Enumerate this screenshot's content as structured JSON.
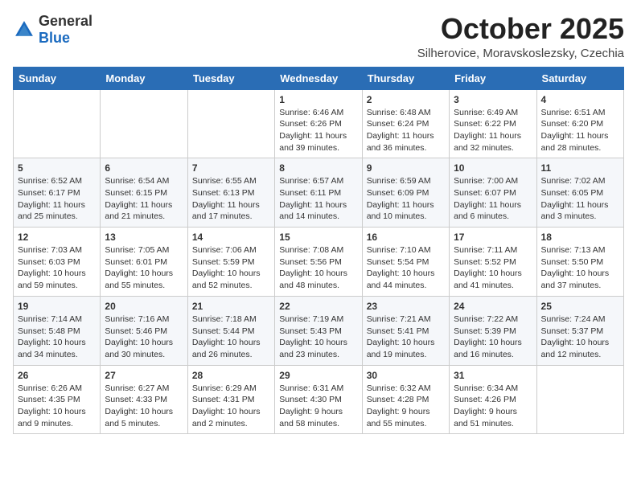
{
  "header": {
    "logo_general": "General",
    "logo_blue": "Blue",
    "month": "October 2025",
    "location": "Silherovice, Moravskoslezsky, Czechia"
  },
  "weekdays": [
    "Sunday",
    "Monday",
    "Tuesday",
    "Wednesday",
    "Thursday",
    "Friday",
    "Saturday"
  ],
  "weeks": [
    [
      {
        "day": "",
        "info": ""
      },
      {
        "day": "",
        "info": ""
      },
      {
        "day": "",
        "info": ""
      },
      {
        "day": "1",
        "info": "Sunrise: 6:46 AM\nSunset: 6:26 PM\nDaylight: 11 hours\nand 39 minutes."
      },
      {
        "day": "2",
        "info": "Sunrise: 6:48 AM\nSunset: 6:24 PM\nDaylight: 11 hours\nand 36 minutes."
      },
      {
        "day": "3",
        "info": "Sunrise: 6:49 AM\nSunset: 6:22 PM\nDaylight: 11 hours\nand 32 minutes."
      },
      {
        "day": "4",
        "info": "Sunrise: 6:51 AM\nSunset: 6:20 PM\nDaylight: 11 hours\nand 28 minutes."
      }
    ],
    [
      {
        "day": "5",
        "info": "Sunrise: 6:52 AM\nSunset: 6:17 PM\nDaylight: 11 hours\nand 25 minutes."
      },
      {
        "day": "6",
        "info": "Sunrise: 6:54 AM\nSunset: 6:15 PM\nDaylight: 11 hours\nand 21 minutes."
      },
      {
        "day": "7",
        "info": "Sunrise: 6:55 AM\nSunset: 6:13 PM\nDaylight: 11 hours\nand 17 minutes."
      },
      {
        "day": "8",
        "info": "Sunrise: 6:57 AM\nSunset: 6:11 PM\nDaylight: 11 hours\nand 14 minutes."
      },
      {
        "day": "9",
        "info": "Sunrise: 6:59 AM\nSunset: 6:09 PM\nDaylight: 11 hours\nand 10 minutes."
      },
      {
        "day": "10",
        "info": "Sunrise: 7:00 AM\nSunset: 6:07 PM\nDaylight: 11 hours\nand 6 minutes."
      },
      {
        "day": "11",
        "info": "Sunrise: 7:02 AM\nSunset: 6:05 PM\nDaylight: 11 hours\nand 3 minutes."
      }
    ],
    [
      {
        "day": "12",
        "info": "Sunrise: 7:03 AM\nSunset: 6:03 PM\nDaylight: 10 hours\nand 59 minutes."
      },
      {
        "day": "13",
        "info": "Sunrise: 7:05 AM\nSunset: 6:01 PM\nDaylight: 10 hours\nand 55 minutes."
      },
      {
        "day": "14",
        "info": "Sunrise: 7:06 AM\nSunset: 5:59 PM\nDaylight: 10 hours\nand 52 minutes."
      },
      {
        "day": "15",
        "info": "Sunrise: 7:08 AM\nSunset: 5:56 PM\nDaylight: 10 hours\nand 48 minutes."
      },
      {
        "day": "16",
        "info": "Sunrise: 7:10 AM\nSunset: 5:54 PM\nDaylight: 10 hours\nand 44 minutes."
      },
      {
        "day": "17",
        "info": "Sunrise: 7:11 AM\nSunset: 5:52 PM\nDaylight: 10 hours\nand 41 minutes."
      },
      {
        "day": "18",
        "info": "Sunrise: 7:13 AM\nSunset: 5:50 PM\nDaylight: 10 hours\nand 37 minutes."
      }
    ],
    [
      {
        "day": "19",
        "info": "Sunrise: 7:14 AM\nSunset: 5:48 PM\nDaylight: 10 hours\nand 34 minutes."
      },
      {
        "day": "20",
        "info": "Sunrise: 7:16 AM\nSunset: 5:46 PM\nDaylight: 10 hours\nand 30 minutes."
      },
      {
        "day": "21",
        "info": "Sunrise: 7:18 AM\nSunset: 5:44 PM\nDaylight: 10 hours\nand 26 minutes."
      },
      {
        "day": "22",
        "info": "Sunrise: 7:19 AM\nSunset: 5:43 PM\nDaylight: 10 hours\nand 23 minutes."
      },
      {
        "day": "23",
        "info": "Sunrise: 7:21 AM\nSunset: 5:41 PM\nDaylight: 10 hours\nand 19 minutes."
      },
      {
        "day": "24",
        "info": "Sunrise: 7:22 AM\nSunset: 5:39 PM\nDaylight: 10 hours\nand 16 minutes."
      },
      {
        "day": "25",
        "info": "Sunrise: 7:24 AM\nSunset: 5:37 PM\nDaylight: 10 hours\nand 12 minutes."
      }
    ],
    [
      {
        "day": "26",
        "info": "Sunrise: 6:26 AM\nSunset: 4:35 PM\nDaylight: 10 hours\nand 9 minutes."
      },
      {
        "day": "27",
        "info": "Sunrise: 6:27 AM\nSunset: 4:33 PM\nDaylight: 10 hours\nand 5 minutes."
      },
      {
        "day": "28",
        "info": "Sunrise: 6:29 AM\nSunset: 4:31 PM\nDaylight: 10 hours\nand 2 minutes."
      },
      {
        "day": "29",
        "info": "Sunrise: 6:31 AM\nSunset: 4:30 PM\nDaylight: 9 hours\nand 58 minutes."
      },
      {
        "day": "30",
        "info": "Sunrise: 6:32 AM\nSunset: 4:28 PM\nDaylight: 9 hours\nand 55 minutes."
      },
      {
        "day": "31",
        "info": "Sunrise: 6:34 AM\nSunset: 4:26 PM\nDaylight: 9 hours\nand 51 minutes."
      },
      {
        "day": "",
        "info": ""
      }
    ]
  ]
}
